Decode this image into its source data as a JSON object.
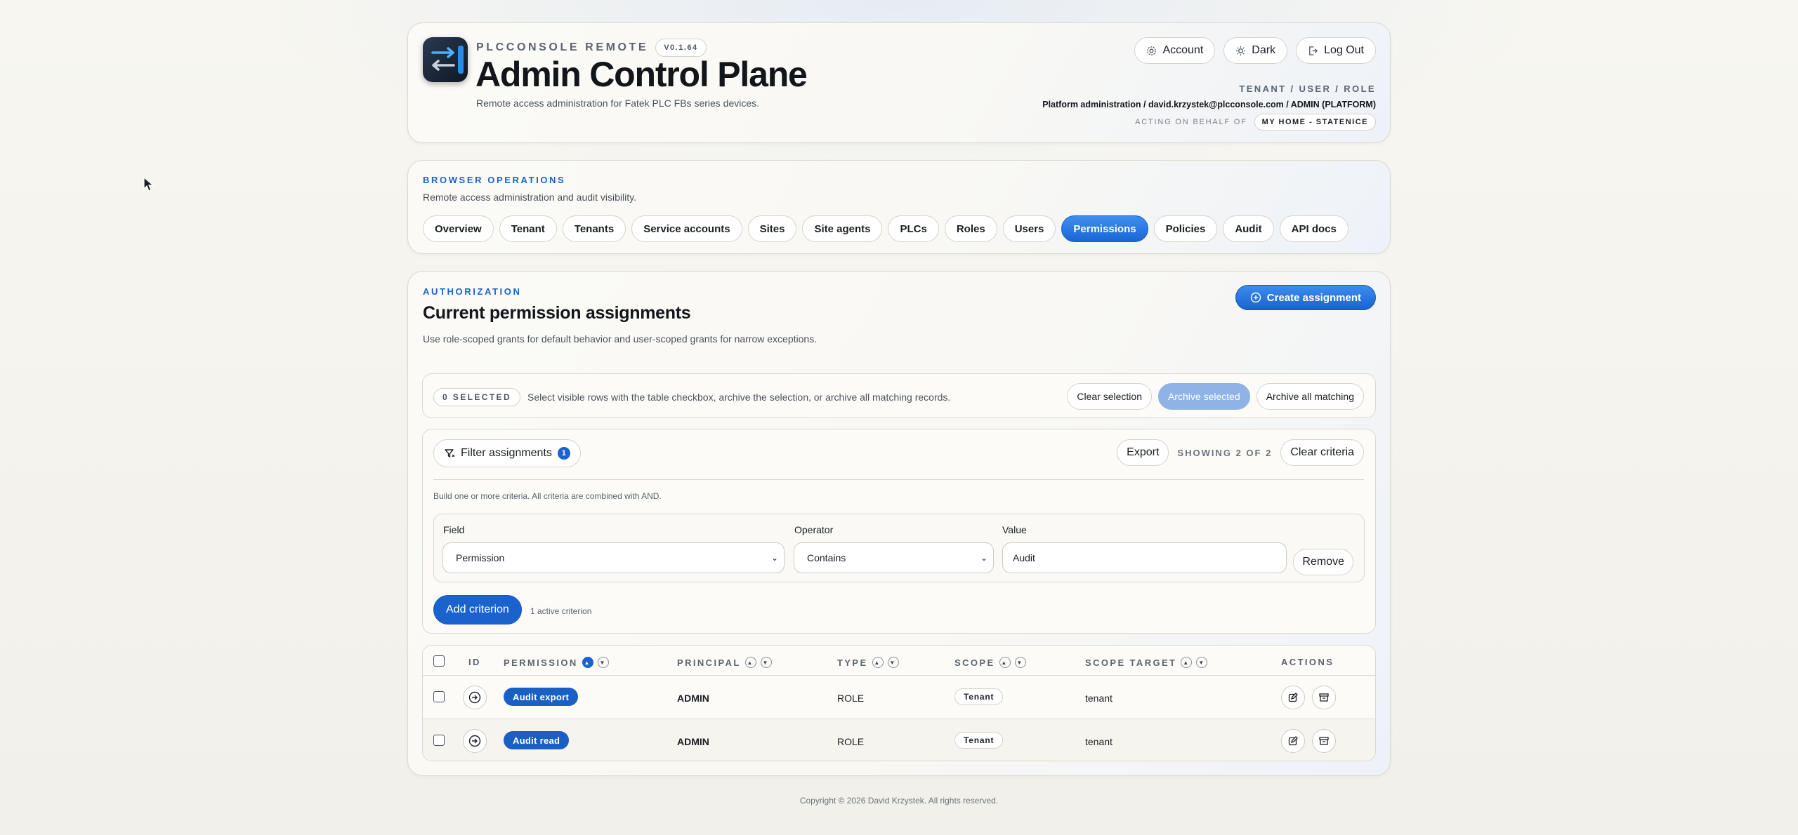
{
  "header": {
    "brand": "PLCCONSOLE REMOTE",
    "version": "V0.1.64",
    "title": "Admin Control Plane",
    "subtitle": "Remote access administration for Fatek PLC FBs series devices.",
    "buttons": {
      "account": "Account",
      "theme": "Dark",
      "logout": "Log Out"
    },
    "context_label": "TENANT / USER / ROLE",
    "context_value": "Platform administration / david.krzystek@plcconsole.com / ADMIN (PLATFORM)",
    "acting_label": "ACTING ON BEHALF OF",
    "acting_tenant": "MY HOME - STATENICE"
  },
  "ops": {
    "eyebrow": "BROWSER OPERATIONS",
    "description": "Remote access administration and audit visibility.",
    "tabs": [
      "Overview",
      "Tenant",
      "Tenants",
      "Service accounts",
      "Sites",
      "Site agents",
      "PLCs",
      "Roles",
      "Users",
      "Permissions",
      "Policies",
      "Audit",
      "API docs"
    ],
    "active_tab": "Permissions"
  },
  "permissions": {
    "eyebrow": "AUTHORIZATION",
    "title": "Current permission assignments",
    "description": "Use role-scoped grants for default behavior and user-scoped grants for narrow exceptions.",
    "create_label": "Create assignment",
    "selection": {
      "count": "0 SELECTED",
      "hint": "Select visible rows with the table checkbox, archive the selection, or archive all matching records.",
      "clear": "Clear selection",
      "archive_selected": "Archive selected",
      "archive_all": "Archive all matching"
    },
    "filter": {
      "toggle_label": "Filter assignments",
      "badge": "1",
      "export": "Export",
      "showing": "SHOWING 2 OF 2",
      "clear_criteria": "Clear criteria",
      "hint": "Build one or more criteria. All criteria are combined with AND.",
      "field_label": "Field",
      "field_value": "Permission",
      "operator_label": "Operator",
      "operator_value": "Contains",
      "value_label": "Value",
      "value_value": "Audit",
      "remove": "Remove",
      "add": "Add criterion",
      "active_count": "1 active criterion"
    },
    "table": {
      "headers": {
        "id": "ID",
        "permission": "PERMISSION",
        "principal": "PRINCIPAL",
        "type": "TYPE",
        "scope": "SCOPE",
        "scope_target": "SCOPE TARGET",
        "actions": "ACTIONS"
      },
      "rows": [
        {
          "permission": "Audit export",
          "principal": "ADMIN",
          "type": "ROLE",
          "scope": "Tenant",
          "scope_target": "tenant"
        },
        {
          "permission": "Audit read",
          "principal": "ADMIN",
          "type": "ROLE",
          "scope": "Tenant",
          "scope_target": "tenant"
        }
      ]
    }
  },
  "footer": "Copyright © 2026 David Krzystek. All rights reserved.",
  "colors": {
    "accent": "#1a63cf",
    "accent_light": "#3d8ff0",
    "disabled": "#8fb3e7"
  }
}
